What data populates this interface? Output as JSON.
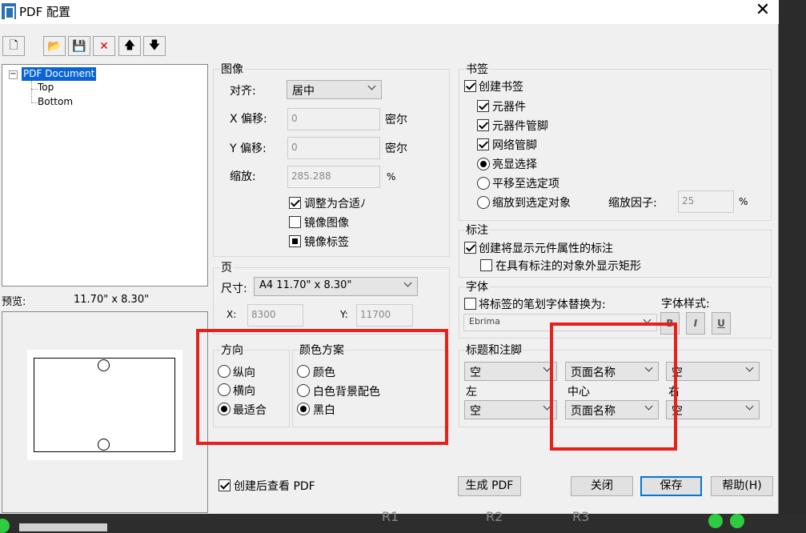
{
  "window": {
    "title": "PDF 配置",
    "close": "✕"
  },
  "toolbar": {
    "new": "🗋",
    "open": "📂",
    "save": "💾",
    "delete": "✕",
    "up": "🡅",
    "down": "🡇"
  },
  "tree": {
    "root": "PDF Document",
    "children": [
      "Top",
      "Bottom"
    ],
    "expander": "−"
  },
  "preview": {
    "label": "预览:",
    "size": "11.70\" x  8.30\""
  },
  "image": {
    "group": "图像",
    "align_label": "对齐:",
    "align_value": "居中",
    "x_offset_label": "X 偏移:",
    "x_offset_value": "0",
    "x_unit": "密尔",
    "y_offset_label": "Y 偏移:",
    "y_offset_value": "0",
    "y_unit": "密尔",
    "scale_label": "缩放:",
    "scale_value": "285.288",
    "scale_unit": "%",
    "fit": "调整为合适ﾉ",
    "mirror_image": "镜像图像",
    "mirror_label": "镜像标签"
  },
  "page": {
    "group": "页",
    "size_label": "尺寸:",
    "size_value": "A4   11.70\" x  8.30\"",
    "x_label": "X:",
    "x_value": "8300",
    "y_label": "Y:",
    "y_value": "11700"
  },
  "orientation": {
    "group": "方向",
    "options": [
      "纵向",
      "横向",
      "最适合"
    ]
  },
  "color_scheme": {
    "group": "颜色方案",
    "options": [
      "颜色",
      "白色背景配色",
      "黑白"
    ]
  },
  "view_after_create": "创建后查看 PDF",
  "bookmarks": {
    "group": "书签",
    "create": "创建书签",
    "components": "元器件",
    "component_pins": "元器件管脚",
    "net_pins": "网络管脚",
    "highlight": "亮显选择",
    "pan": "平移至选定项",
    "zoom": "缩放到选定对象",
    "zoom_factor_label": "缩放因子:",
    "zoom_factor_value": "25",
    "zoom_unit": "%"
  },
  "annotation": {
    "group": "标注",
    "create": "创建将显示元件属性的标注",
    "rect": "在具有标注的对象外显示矩形"
  },
  "font": {
    "group": "字体",
    "replace": "将标签的笔划字体替换为:",
    "font_value": "Ebrima",
    "style_label": "字体样式:",
    "bold": "B",
    "italic": "I",
    "underline": "U"
  },
  "header_footer": {
    "group": "标题和注脚",
    "left_label": "左",
    "center_label": "中心",
    "right_label": "右",
    "left_top": "空",
    "center_top": "页面名称",
    "right_top": "空",
    "left_bottom": "空",
    "center_bottom": "页面名称",
    "right_bottom": "空"
  },
  "buttons": {
    "generate": "生成 PDF",
    "close": "关闭",
    "save": "保存",
    "help": "帮助(H)"
  },
  "background_text": [
    "R1",
    "R2",
    "R3"
  ],
  "colors": {
    "highlight": "#e6201c",
    "selection": "#0a64d7",
    "default_border": "#0078d7"
  }
}
